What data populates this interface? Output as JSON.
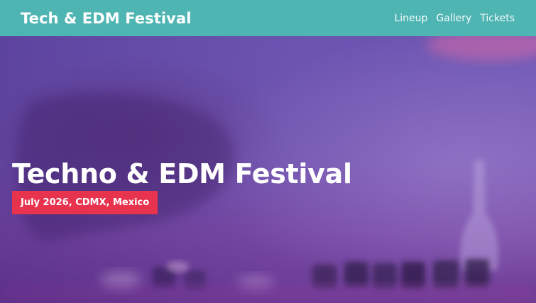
{
  "navbar": {
    "brand": "Tech & EDM Festival",
    "links": [
      "Lineup",
      "Gallery",
      "Tickets"
    ]
  },
  "hero": {
    "title": "Techno & EDM Festival",
    "badge": "July 2026, CDMX, Mexico"
  },
  "colors": {
    "navbar_bg": "#4fb5b3",
    "badge_bg": "#e8334f",
    "hero_tint": "#6e58b4"
  }
}
